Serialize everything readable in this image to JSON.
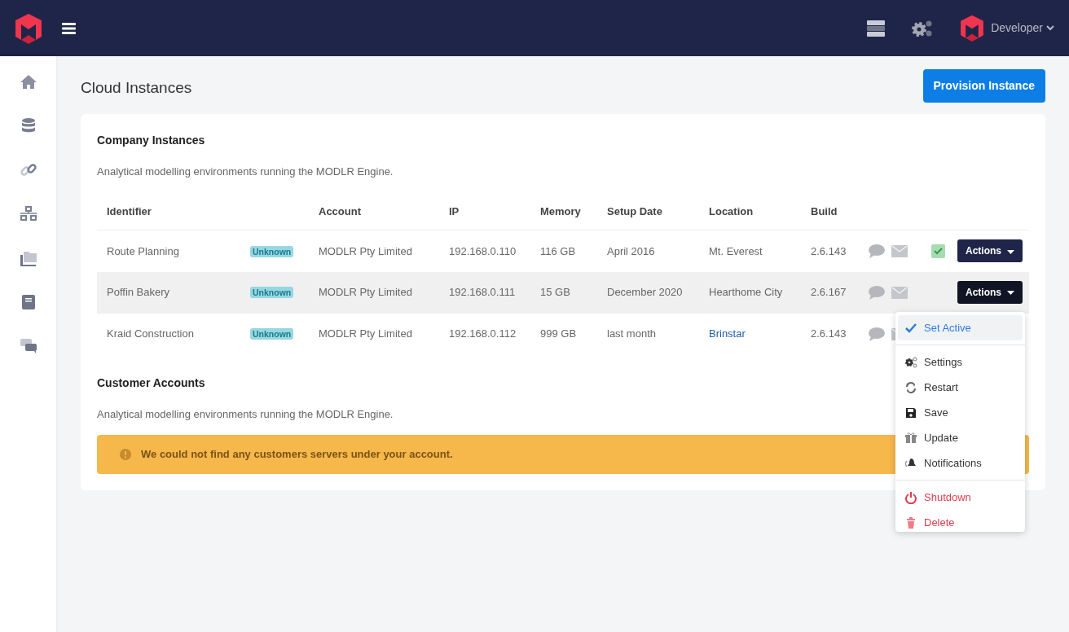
{
  "topbar": {
    "user": "Developer"
  },
  "sidebar": {
    "items": [
      {
        "selected": false
      },
      {
        "selected": false
      },
      {
        "selected": false
      },
      {
        "selected": false
      },
      {
        "selected": false
      },
      {
        "selected": false
      },
      {
        "selected": false
      }
    ]
  },
  "page": {
    "title": "Cloud Instances",
    "primary_button": "Provision Instance"
  },
  "company": {
    "title": "Company Instances",
    "subtitle": "Analytical modelling environments running the MODLR Engine.",
    "columns": [
      "Identifier",
      "Account",
      "IP",
      "Memory",
      "Setup Date",
      "Location",
      "Build"
    ],
    "rows": [
      {
        "identifier": "Route Planning",
        "status": "Unknown",
        "account": "MODLR Pty Limited",
        "ip": "192.168.0.110",
        "memory": "116 GB",
        "setup_date": "April 2016",
        "location": "Mt. Everest",
        "location_link": false,
        "build": "2.6.143",
        "active": true,
        "selected": false,
        "actions": "Actions",
        "menu_open": false
      },
      {
        "identifier": "Poffin Bakery",
        "status": "Unknown",
        "account": "MODLR Pty Limited",
        "ip": "192.168.0.111",
        "memory": "15 GB",
        "setup_date": "December 2020",
        "location": "Hearthome City",
        "location_link": false,
        "build": "2.6.167",
        "active": false,
        "selected": true,
        "actions": "Actions",
        "menu_open": true
      },
      {
        "identifier": "Kraid Construction",
        "status": "Unknown",
        "account": "MODLR Pty Limited",
        "ip": "192.168.0.112",
        "memory": "999 GB",
        "setup_date": "last month",
        "location": "Brinstar",
        "location_link": true,
        "build": "2.6.143",
        "active": false,
        "selected": false,
        "menu_open": false
      }
    ]
  },
  "actions_menu": {
    "groups": [
      [
        {
          "label": "Set Active",
          "kind": "highlighted"
        }
      ],
      [
        {
          "label": "Settings",
          "kind": "normal"
        },
        {
          "label": "Restart",
          "kind": "normal"
        },
        {
          "label": "Save",
          "kind": "normal"
        },
        {
          "label": "Update",
          "kind": "normal"
        },
        {
          "label": "Notifications",
          "kind": "normal"
        }
      ],
      [
        {
          "label": "Shutdown",
          "kind": "danger"
        },
        {
          "label": "Delete",
          "kind": "danger"
        }
      ]
    ]
  },
  "customers": {
    "title": "Customer Accounts",
    "subtitle": "Analytical modelling environments running the MODLR Engine.",
    "alert": "We could not find any customers servers under your account."
  }
}
